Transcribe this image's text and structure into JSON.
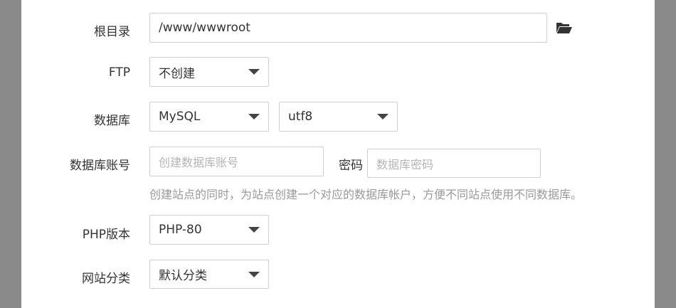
{
  "form": {
    "root_dir": {
      "label": "根目录",
      "value": "/www/wwwroot"
    },
    "ftp": {
      "label": "FTP",
      "value": "不创建"
    },
    "database": {
      "label": "数据库",
      "type_value": "MySQL",
      "charset_value": "utf8"
    },
    "db_account": {
      "label": "数据库账号",
      "account_placeholder": "创建数据库账号",
      "password_label": "密码",
      "password_placeholder": "数据库密码",
      "hint": "创建站点的同时，为站点创建一个对应的数据库帐户，方便不同站点使用不同数据库。"
    },
    "php_version": {
      "label": "PHP版本",
      "value": "PHP-80"
    },
    "site_category": {
      "label": "网站分类",
      "value": "默认分类"
    }
  }
}
